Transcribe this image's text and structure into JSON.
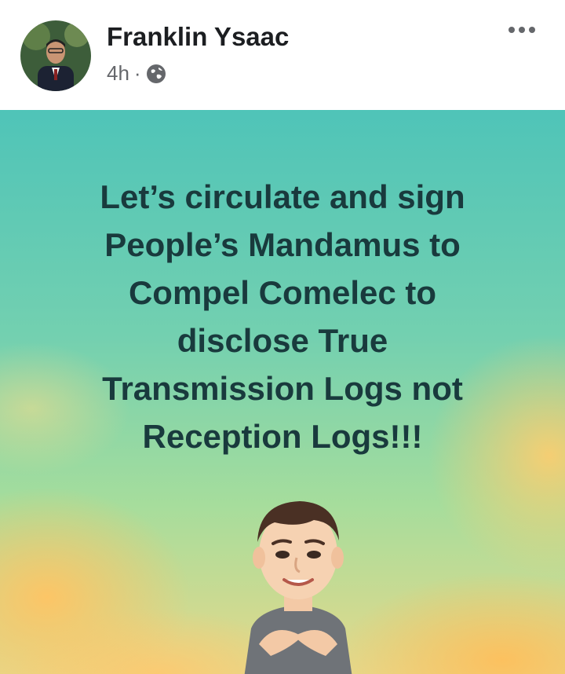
{
  "post": {
    "author": "Franklin Ysaac",
    "time": "4h",
    "separator": "·",
    "privacy_icon": "globe-icon",
    "more_icon": "more-options-icon",
    "lines": [
      "Let’s circulate and sign",
      "People’s Mandamus to",
      "Compel Comelec to",
      "disclose True",
      "Transmission Logs not",
      "Reception Logs!!!"
    ],
    "text_color": "#193a3d"
  }
}
